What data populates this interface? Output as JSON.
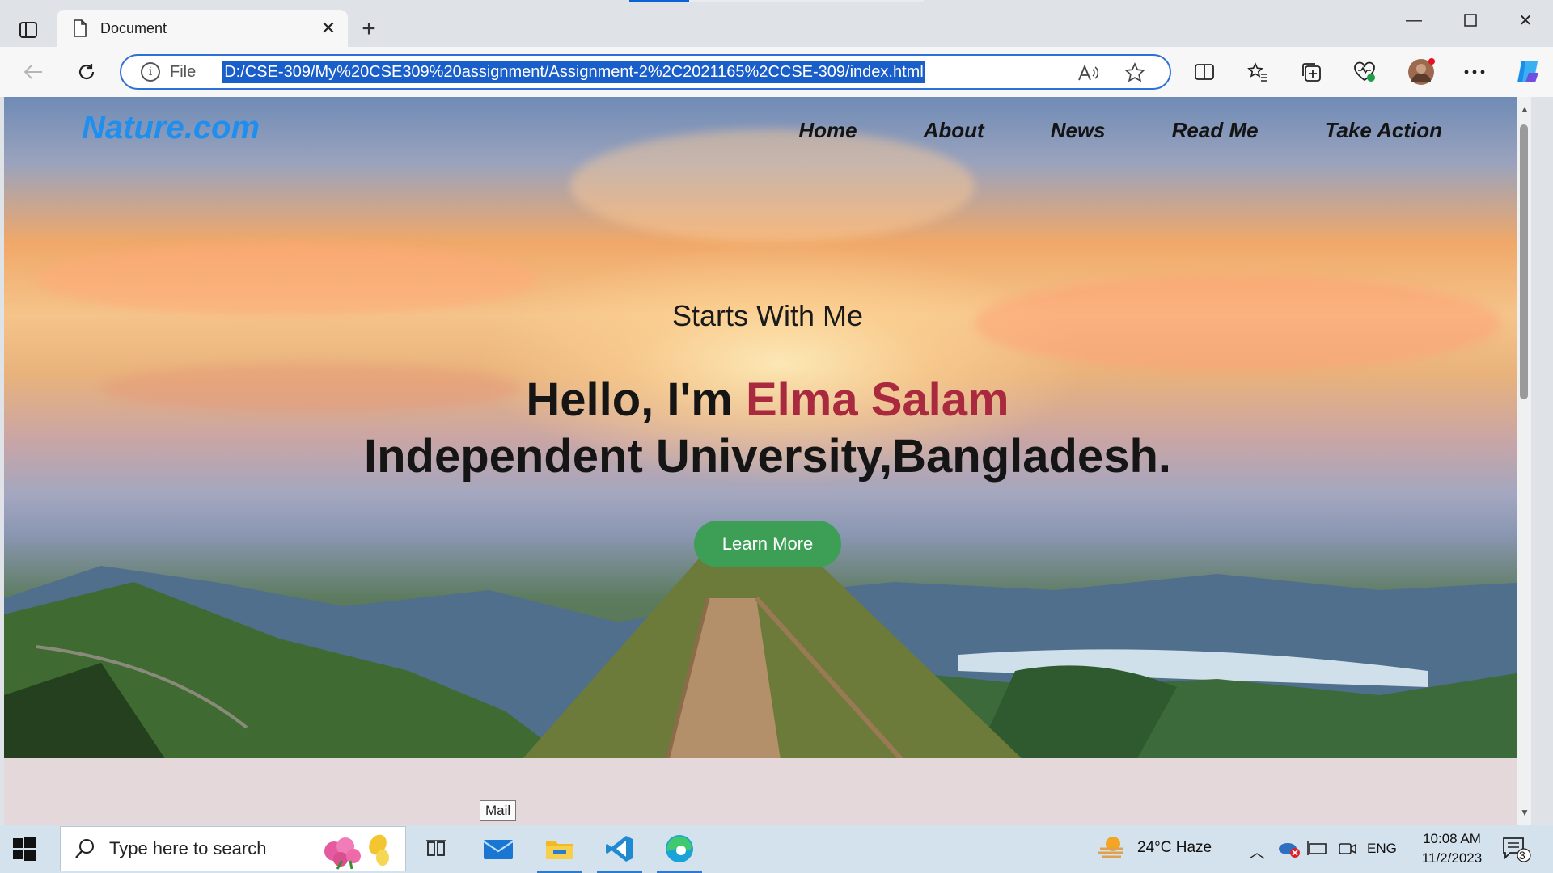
{
  "browser": {
    "tab_title": "Document",
    "address_prefix": "File",
    "url": "D:/CSE-309/My%20CSE309%20assignment/Assignment-2%2C2021165%2CCSE-309/index.html"
  },
  "page": {
    "brand": "Nature.com",
    "nav": [
      "Home",
      "About",
      "News",
      "Read Me",
      "Take Action"
    ],
    "tagline": "Starts With Me",
    "greeting": "Hello, I'm ",
    "name": "Elma Salam",
    "institution": "Independent University,Bangladesh.",
    "cta": "Learn More",
    "colors": {
      "brand": "#1e8fef",
      "name": "#a92a3e",
      "cta": "#3c9f55"
    }
  },
  "tooltip": "Mail",
  "taskbar": {
    "search_placeholder": "Type here to search",
    "weather": "24°C  Haze",
    "language": "ENG",
    "time": "10:08 AM",
    "date": "11/2/2023",
    "notifications": "3"
  }
}
